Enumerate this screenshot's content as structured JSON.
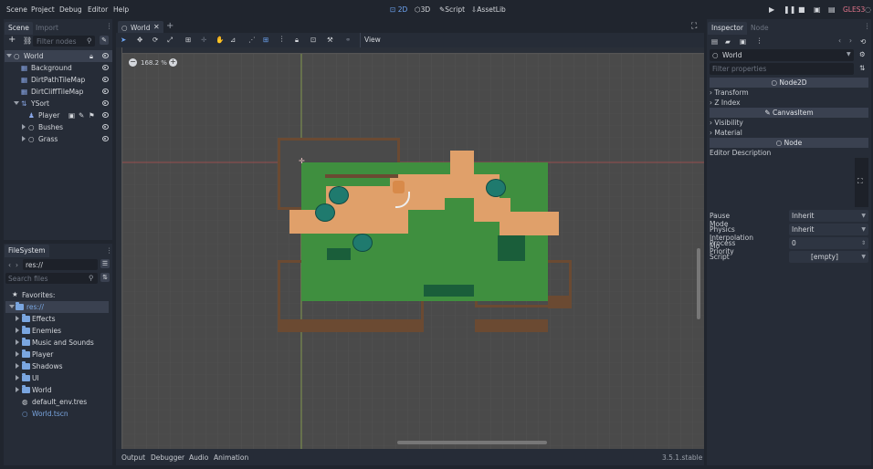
{
  "menu": {
    "items": [
      "Scene",
      "Project",
      "Debug",
      "Editor",
      "Help"
    ],
    "modes": [
      "2D",
      "3D",
      "Script",
      "AssetLib"
    ],
    "active_mode": "2D",
    "renderer": "GLES3"
  },
  "scene_dock": {
    "tabs": [
      "Scene",
      "Import"
    ],
    "filter_placeholder": "Filter nodes",
    "nodes": [
      {
        "name": "World",
        "depth": 0,
        "expanded": true,
        "selected": true,
        "icon": "node2d-icon",
        "lock": true
      },
      {
        "name": "Background",
        "depth": 1,
        "icon": "sprite-icon"
      },
      {
        "name": "DirtPathTileMap",
        "depth": 1,
        "icon": "tilemap-icon"
      },
      {
        "name": "DirtCliffTileMap",
        "depth": 1,
        "icon": "tilemap-icon"
      },
      {
        "name": "YSort",
        "depth": 1,
        "expanded": true,
        "icon": "ysort-icon"
      },
      {
        "name": "Player",
        "depth": 2,
        "icon": "kinematic-icon",
        "extra_icons": true
      },
      {
        "name": "Bushes",
        "depth": 2,
        "collapsed": true,
        "icon": "node2d-icon"
      },
      {
        "name": "Grass",
        "depth": 2,
        "collapsed": true,
        "icon": "node2d-icon"
      }
    ]
  },
  "filesystem": {
    "tab": "FileSystem",
    "path": "res://",
    "search_placeholder": "Search files",
    "favorites_label": "Favorites:",
    "root": "res://",
    "entries": [
      {
        "name": "Effects",
        "type": "folder"
      },
      {
        "name": "Enemies",
        "type": "folder"
      },
      {
        "name": "Music and Sounds",
        "type": "folder"
      },
      {
        "name": "Player",
        "type": "folder"
      },
      {
        "name": "Shadows",
        "type": "folder"
      },
      {
        "name": "UI",
        "type": "folder"
      },
      {
        "name": "World",
        "type": "folder"
      },
      {
        "name": "default_env.tres",
        "type": "resource"
      },
      {
        "name": "World.tscn",
        "type": "scene"
      }
    ]
  },
  "viewport": {
    "tab": "World",
    "view_menu": "View",
    "zoom": "168.2 %"
  },
  "bottom_panel": {
    "tabs": [
      "Output",
      "Debugger",
      "Audio",
      "Animation"
    ],
    "version": "3.5.1.stable"
  },
  "inspector": {
    "tabs": [
      "Inspector",
      "Node"
    ],
    "object": "World",
    "filter_placeholder": "Filter properties",
    "sections": {
      "node2d": "Node2D",
      "canvas_item": "CanvasItem",
      "node": "Node"
    },
    "node2d_props": [
      "Transform",
      "Z Index"
    ],
    "canvas_props": [
      "Visibility",
      "Material"
    ],
    "editor_description": "Editor Description",
    "props": [
      {
        "label": "Pause Mode",
        "value": "Inherit"
      },
      {
        "label": "Physics Interpolation Mo",
        "value": "Inherit"
      },
      {
        "label": "Process Priority",
        "value": "0"
      },
      {
        "label": "Script",
        "value": "[empty]"
      }
    ]
  },
  "colors": {
    "accent": "#6ea6f5",
    "background": "#20252e",
    "panel": "#262c37",
    "renderer": "#e0748a"
  }
}
